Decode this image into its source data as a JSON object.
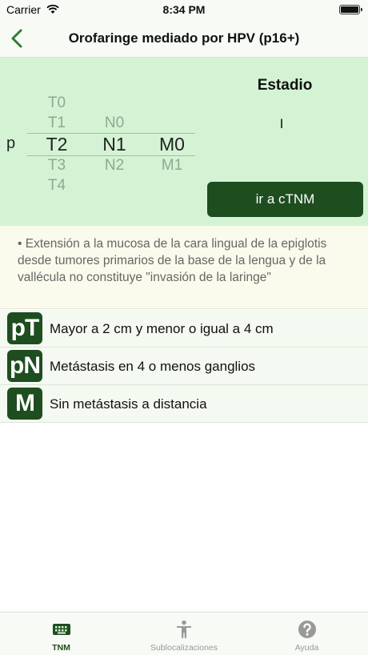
{
  "status_bar": {
    "carrier": "Carrier",
    "time": "8:34 PM"
  },
  "nav": {
    "title": "Orofaringe mediado por HPV (p16+)",
    "back_icon": "chevron-left-icon"
  },
  "picker": {
    "prefix": "p",
    "t_options": [
      "T0",
      "T1",
      "T2",
      "T3",
      "T4"
    ],
    "n_options": [
      "N0",
      "N1",
      "N2"
    ],
    "m_options": [
      "M0",
      "M1"
    ],
    "selected_t": "T2",
    "selected_n": "N1",
    "selected_m": "M0"
  },
  "stage": {
    "label": "Estadio",
    "value": "I"
  },
  "go_button": {
    "label": "ir a cTNM"
  },
  "note": {
    "text": "• Extensión a la mucosa de la cara lingual de la epiglotis desde tumores primarios de la base de la lengua y de la vallécula no constituye \"invasión de la laringe\""
  },
  "rows": [
    {
      "badge": "pT",
      "text": "Mayor a 2 cm y menor o igual a 4 cm"
    },
    {
      "badge": "pN",
      "text": "Metástasis en 4 o menos ganglios"
    },
    {
      "badge": "M",
      "text": "Sin metástasis a distancia"
    }
  ],
  "tabs": [
    {
      "label": "TNM",
      "icon": "keyboard-icon",
      "active": true
    },
    {
      "label": "Sublocalizaciones",
      "icon": "person-icon",
      "active": false
    },
    {
      "label": "Ayuda",
      "icon": "question-icon",
      "active": false
    }
  ],
  "colors": {
    "accent": "#1e4d1f",
    "panel_bg": "#d4f3d4",
    "note_bg": "#fafbec",
    "row_bg": "#f4f9f1"
  }
}
